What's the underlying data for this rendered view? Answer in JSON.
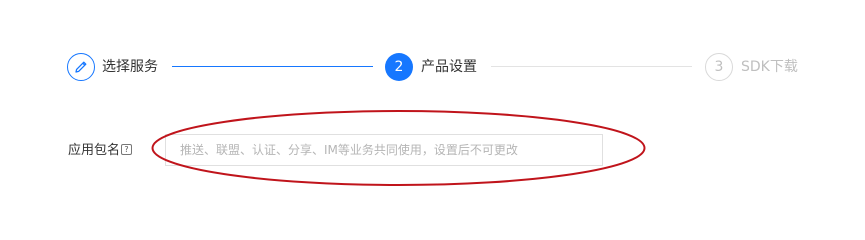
{
  "steps": [
    {
      "number": "",
      "label": "选择服务",
      "state": "done",
      "icon": "pencil-icon"
    },
    {
      "number": "2",
      "label": "产品设置",
      "state": "active"
    },
    {
      "number": "3",
      "label": "SDK下载",
      "state": "pending"
    }
  ],
  "form": {
    "package_name_label": "应用包名",
    "help_icon_glyph": "?",
    "package_name_placeholder": "推送、联盟、认证、分享、IM等业务共同使用，设置后不可更改",
    "package_name_value": ""
  },
  "colors": {
    "primary": "#1677ff",
    "inactive": "#bfbfbf",
    "annotation": "#c0141b"
  }
}
